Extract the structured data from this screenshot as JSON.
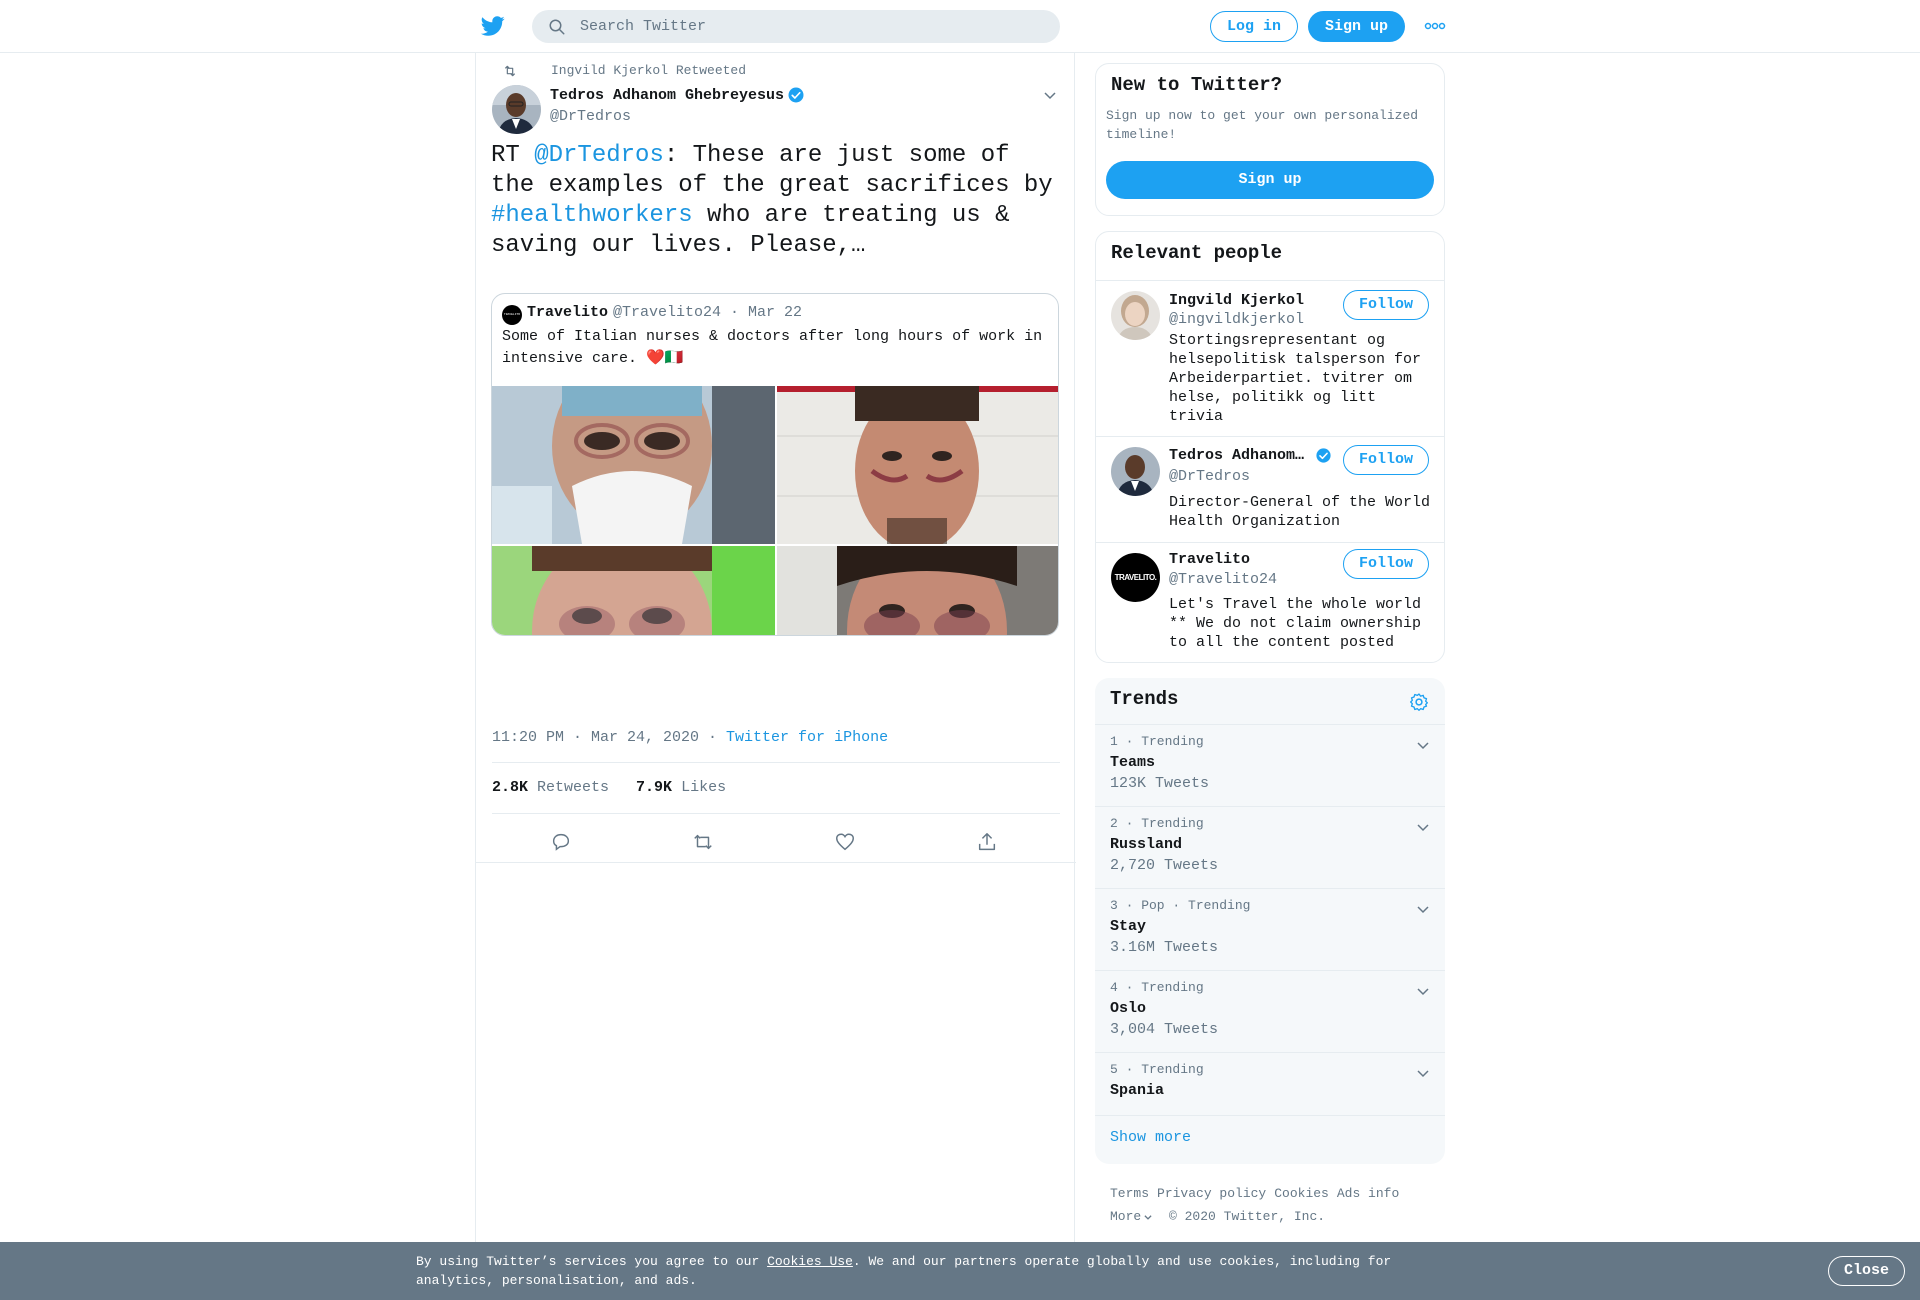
{
  "header": {
    "search_placeholder": "Search Twitter",
    "login_label": "Log in",
    "signup_label": "Sign up",
    "icons": [
      "twitter-bird-icon",
      "search-icon",
      "more-icon"
    ]
  },
  "tweet": {
    "retweeted_by": "Ingvild Kjerkol Retweeted",
    "author_name": "Tedros Adhanom Ghebreyesus",
    "author_handle": "@DrTedros",
    "text_rt": "RT ",
    "text_mention": "@DrTedros",
    "text_part1": ": These are just some of the examples of the great sacrifices by ",
    "text_hashtag": "#healthworkers",
    "text_part2": " who are treating us & saving our lives. Please,…",
    "timestamp": "11:20 PM · Mar 24, 2020 · ",
    "source": "Twitter for iPhone",
    "retweets_count": "2.8K",
    "retweets_label": " Retweets",
    "likes_count": "7.9K",
    "likes_label": " Likes"
  },
  "quoted": {
    "avatar_text": "TRAVELITO",
    "name": "Travelito",
    "handle_date": "@Travelito24 · Mar 22",
    "text": "Some of Italian nurses & doctors after long hours of work in intensive care. ❤️🇮🇹"
  },
  "new_to_twitter": {
    "title": "New to Twitter?",
    "description": "Sign up now to get your own personalized timeline!",
    "signup_label": "Sign up"
  },
  "relevant": {
    "title": "Relevant people",
    "follow_label": "Follow",
    "people": [
      {
        "name": "Ingvild Kjerkol",
        "handle": "@ingvildkjerkol",
        "bio": "Stortingsrepresentant og helsepolitisk talsperson for Arbeiderpartiet. tvitrer om helse, politikk og litt trivia"
      },
      {
        "name": "Tedros Adhanom…",
        "handle": "@DrTedros",
        "bio": "Director-General of the World Health Organization"
      },
      {
        "name": "Travelito",
        "handle": "@Travelito24",
        "bio": "Let's Travel the whole world ** We do not claim ownership to all the content posted",
        "avatar_text": "TRAVELITO."
      }
    ]
  },
  "trends": {
    "title": "Trends",
    "items": [
      {
        "meta": "1 · Trending",
        "name": "Teams",
        "count": "123K Tweets"
      },
      {
        "meta": "2 · Trending",
        "name": "Russland",
        "count": "2,720 Tweets"
      },
      {
        "meta": "3 · Pop · Trending",
        "name": "Stay",
        "count": "3.16M Tweets"
      },
      {
        "meta": "4 · Trending",
        "name": "Oslo",
        "count": "3,004 Tweets"
      },
      {
        "meta": "5 · Trending",
        "name": "Spania",
        "count": ""
      }
    ],
    "show_more": "Show more"
  },
  "footer": {
    "links": [
      "Terms",
      "Privacy policy",
      "Cookies",
      "Ads info"
    ],
    "more": "More",
    "copyright": "© 2020 Twitter, Inc."
  },
  "cookie": {
    "text_before": "By using Twitter’s services you agree to our ",
    "link": "Cookies Use",
    "text_after": ". We and our partners operate globally and use cookies, including for analytics, personalisation, and ads.",
    "close_label": "Close"
  },
  "colors": {
    "accent": "#1da1f2",
    "link": "#1b95e0",
    "muted": "#657786",
    "cookie_bar": "#657786"
  }
}
